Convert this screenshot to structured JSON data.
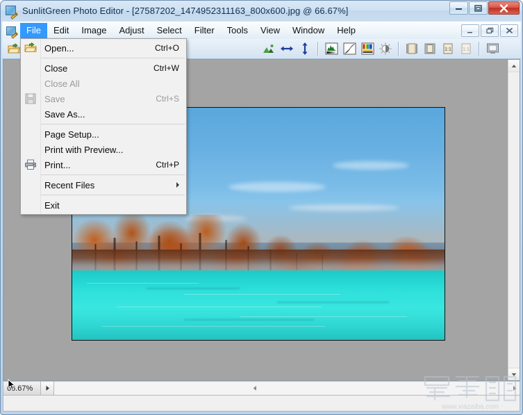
{
  "window": {
    "title": "SunlitGreen Photo Editor - [27587202_1474952311163_800x600.jpg @ 66.67%]",
    "app_icon": "photo-editor-icon",
    "controls": {
      "minimize": "minimize-icon",
      "maximize": "maximize-icon",
      "close": "close-icon"
    }
  },
  "menubar": {
    "items": [
      {
        "label": "File",
        "active": true
      },
      {
        "label": "Edit",
        "active": false
      },
      {
        "label": "Image",
        "active": false
      },
      {
        "label": "Adjust",
        "active": false
      },
      {
        "label": "Select",
        "active": false
      },
      {
        "label": "Filter",
        "active": false
      },
      {
        "label": "Tools",
        "active": false
      },
      {
        "label": "View",
        "active": false
      },
      {
        "label": "Window",
        "active": false
      },
      {
        "label": "Help",
        "active": false
      }
    ],
    "mdi_controls": {
      "minimize": "mdi-minimize-icon",
      "restore": "mdi-restore-icon",
      "close": "mdi-close-icon"
    }
  },
  "file_menu": {
    "items": [
      {
        "label": "Open...",
        "accel": "Ctrl+O",
        "icon": "open-folder-icon",
        "disabled": false,
        "submenu": false
      },
      {
        "separator": true
      },
      {
        "label": "Close",
        "accel": "Ctrl+W",
        "icon": "",
        "disabled": false,
        "submenu": false
      },
      {
        "label": "Close All",
        "accel": "",
        "icon": "",
        "disabled": true,
        "submenu": false
      },
      {
        "label": "Save",
        "accel": "Ctrl+S",
        "icon": "save-disk-icon",
        "disabled": true,
        "submenu": false
      },
      {
        "label": "Save As...",
        "accel": "",
        "icon": "",
        "disabled": false,
        "submenu": false
      },
      {
        "separator": true
      },
      {
        "label": "Page Setup...",
        "accel": "",
        "icon": "",
        "disabled": false,
        "submenu": false
      },
      {
        "label": "Print with Preview...",
        "accel": "",
        "icon": "",
        "disabled": false,
        "submenu": false
      },
      {
        "label": "Print...",
        "accel": "Ctrl+P",
        "icon": "printer-icon",
        "disabled": false,
        "submenu": false
      },
      {
        "separator": true
      },
      {
        "label": "Recent Files",
        "accel": "",
        "icon": "",
        "disabled": false,
        "submenu": true
      },
      {
        "separator": true
      },
      {
        "label": "Exit",
        "accel": "",
        "icon": "",
        "disabled": false,
        "submenu": false
      }
    ]
  },
  "toolbar": {
    "groups": [
      {
        "buttons": [
          {
            "icon": "open-folder-icon"
          },
          {
            "icon": "save-disk-icon"
          },
          {
            "icon": "print-icon"
          }
        ]
      },
      {
        "buttons": [
          {
            "icon": "undo-icon"
          },
          {
            "icon": "redo-icon"
          }
        ]
      },
      {
        "buttons": [
          {
            "icon": "crop-icon"
          },
          {
            "icon": "resize-icon"
          }
        ]
      },
      {
        "buttons": [
          {
            "icon": "rotate-left-icon"
          },
          {
            "icon": "rotate-right-icon"
          },
          {
            "icon": "auto-level-icon"
          },
          {
            "icon": "flip-horizontal-icon"
          },
          {
            "icon": "flip-vertical-icon"
          }
        ]
      },
      {
        "buttons": [
          {
            "icon": "histogram-icon"
          },
          {
            "icon": "curves-icon"
          },
          {
            "icon": "color-balance-icon"
          },
          {
            "icon": "brightness-contrast-icon"
          }
        ]
      },
      {
        "buttons": [
          {
            "icon": "fit-window-icon"
          },
          {
            "icon": "fit-page-icon"
          },
          {
            "icon": "actual-size-icon"
          },
          {
            "icon": "zoom-reset-icon"
          }
        ]
      },
      {
        "buttons": [
          {
            "icon": "fullscreen-icon"
          }
        ]
      }
    ]
  },
  "canvas": {
    "image_name": "27587202_1474952311163_800x600.jpg",
    "photo_alt": "autumn-lakeside-photo"
  },
  "statusbar": {
    "zoom_value": "66.67%",
    "stepper_icon": "zoom-stepper-arrow-icon",
    "message": ""
  },
  "scrollbars": {
    "vertical_up": "scroll-up-arrow-icon",
    "vertical_down": "scroll-down-arrow-icon",
    "horizontal_left": "scroll-left-arrow-icon",
    "horizontal_right": "scroll-right-arrow-icon"
  },
  "watermark": {
    "url": "www.xiazaiba.com",
    "logo": "xiazaiba-logo"
  },
  "colors": {
    "menu_highlight": "#3399ff",
    "title_text": "#10304f",
    "workspace": "#a4a4a4",
    "close_button": "#bf2f20",
    "water": "#2fe0db",
    "foliage": "#b2541a",
    "sky": "#68b0e2"
  }
}
